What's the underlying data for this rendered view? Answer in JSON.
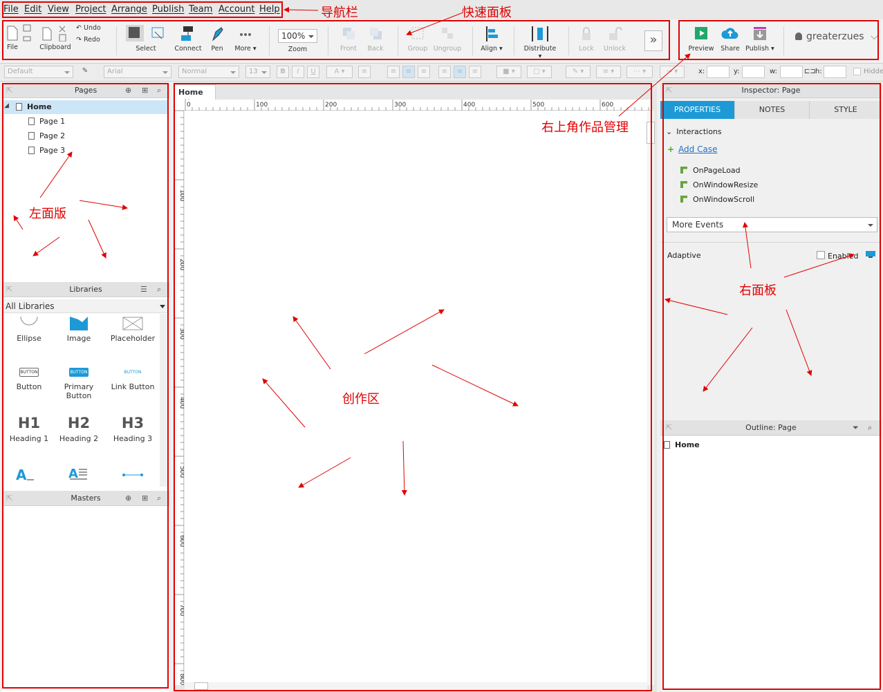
{
  "menubar": {
    "items": [
      "File",
      "Edit",
      "View",
      "Project",
      "Arrange",
      "Publish",
      "Team",
      "Account",
      "Help"
    ]
  },
  "toolbar": {
    "file": "File",
    "clipboard": "Clipboard",
    "undo": "Undo",
    "redo": "Redo",
    "select": "Select",
    "connect": "Connect",
    "pen": "Pen",
    "more": "More ▾",
    "zoom_value": "100%",
    "zoom": "Zoom",
    "front": "Front",
    "back": "Back",
    "group": "Group",
    "ungroup": "Ungroup",
    "align": "Align ▾",
    "distribute": "Distribute ▾",
    "lock": "Lock",
    "unlock": "Unlock",
    "overflow": "»",
    "preview": "Preview",
    "share": "Share",
    "publish": "Publish ▾",
    "user": "greaterzues"
  },
  "formatbar": {
    "style": "Default",
    "font": "Arial",
    "weight": "Normal",
    "size": "13",
    "x_label": "x:",
    "y_label": "y:",
    "w_label": "w:",
    "h_label": "h:",
    "hidden_label": "Hidde"
  },
  "pages": {
    "title": "Pages",
    "home": "Home",
    "items": [
      "Page 1",
      "Page 2",
      "Page 3"
    ]
  },
  "libraries": {
    "title": "Libraries",
    "selector": "All Libraries",
    "items": [
      "Ellipse",
      "Image",
      "Placeholder",
      "Button",
      "Primary Button",
      "Link Button",
      "Heading 1",
      "Heading 2",
      "Heading 3"
    ],
    "icon_texts": [
      "BUTTON",
      "BUTTON",
      "BUTTON",
      "H1",
      "H2",
      "H3"
    ]
  },
  "masters": {
    "title": "Masters"
  },
  "canvas": {
    "tab": "Home",
    "ruler_h": [
      "0",
      "100",
      "200",
      "300",
      "400",
      "500",
      "600"
    ],
    "ruler_v": [
      "100",
      "200",
      "300",
      "400",
      "500",
      "600",
      "700",
      "800"
    ]
  },
  "inspector": {
    "title": "Inspector: Page",
    "tabs": [
      "PROPERTIES",
      "NOTES",
      "STYLE"
    ],
    "interactions": "Interactions",
    "add_case": "Add Case",
    "events": [
      "OnPageLoad",
      "OnWindowResize",
      "OnWindowScroll"
    ],
    "more_events": "More Events",
    "adaptive": "Adaptive",
    "enabled": "Enabled"
  },
  "outline": {
    "title": "Outline: Page",
    "home": "Home"
  },
  "annotations": {
    "nav": "导航栏",
    "quick": "快速面板",
    "topright": "右上角作品管理",
    "left": "左面版",
    "canvas": "创作区",
    "right": "右面板"
  },
  "colors": {
    "annotation": "#e00000",
    "accent": "#1d9ad6",
    "toolbar_bg": "#f2f2f2"
  }
}
